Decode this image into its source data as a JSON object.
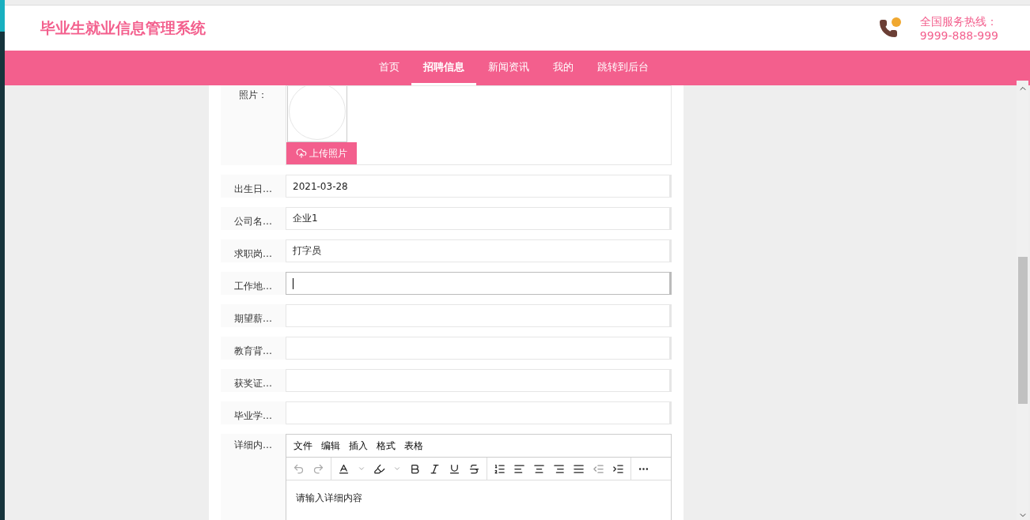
{
  "header": {
    "title": "毕业生就业信息管理系统",
    "hotline_label": "全国服务热线：",
    "hotline_number": "9999-888-999"
  },
  "nav": [
    {
      "label": "首页",
      "selected": false
    },
    {
      "label": "招聘信息",
      "selected": true
    },
    {
      "label": "新闻资讯",
      "selected": false
    },
    {
      "label": "我的",
      "selected": false
    },
    {
      "label": "跳转到后台",
      "selected": false
    }
  ],
  "form": {
    "photo": {
      "label": "照片：",
      "upload_button": "上传照片"
    },
    "fields": [
      {
        "label": "出生日…",
        "value": "2021-03-28",
        "focused": false
      },
      {
        "label": "公司名…",
        "value": "企业1",
        "focused": false
      },
      {
        "label": "求职岗…",
        "value": "打字员",
        "focused": false
      },
      {
        "label": "工作地…",
        "focused": true
      },
      {
        "label": "期望薪…",
        "focused": false
      },
      {
        "label": "教育背…",
        "focused": false
      },
      {
        "label": "获奖证…",
        "focused": false
      },
      {
        "label": "毕业学…",
        "focused": false
      }
    ],
    "editor": {
      "label": "详细内…",
      "menu": [
        "文件",
        "编辑",
        "插入",
        "格式",
        "表格"
      ],
      "history_disabled": true,
      "placeholder": "请输入详细内容"
    }
  }
}
